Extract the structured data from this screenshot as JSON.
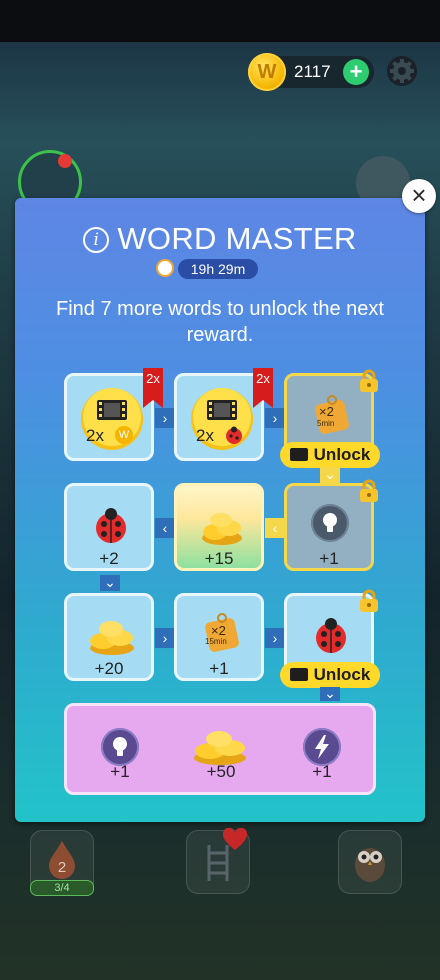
{
  "header": {
    "coins": "2117",
    "coin_symbol": "W"
  },
  "dialog": {
    "title": "WORD MASTER",
    "info_glyph": "i",
    "timer": "19h 29m",
    "subtitle": "Find 7 more words to unlock the next reward.",
    "close_glyph": "×"
  },
  "grid": {
    "r1c1": {
      "label": "2x",
      "badge": "2x",
      "icon": "film-coin-icon",
      "mini": "W"
    },
    "r1c2": {
      "label": "2x",
      "badge": "2x",
      "icon": "film-ladybug-icon"
    },
    "r1c3": {
      "tag_top": "×2",
      "tag_bottom": "5min",
      "button": "Unlock",
      "icon": "boost-tag-icon"
    },
    "r2c1": {
      "label": "+2",
      "icon": "ladybug-icon"
    },
    "r2c2": {
      "label": "+15",
      "icon": "coin-pile-icon"
    },
    "r2c3": {
      "label": "+1",
      "icon": "lightbulb-icon"
    },
    "r3c1": {
      "label": "+20",
      "icon": "coin-pile-icon"
    },
    "r3c2": {
      "label": "+1",
      "tag_top": "×2",
      "tag_bottom": "15min",
      "icon": "boost-tag-icon"
    },
    "r3c3": {
      "button": "Unlock",
      "icon": "ladybug-icon"
    }
  },
  "bonus": {
    "items": [
      {
        "label": "+1",
        "icon": "lightbulb-icon"
      },
      {
        "label": "+50",
        "icon": "coin-pile-icon"
      },
      {
        "label": "+1",
        "icon": "lightning-icon"
      }
    ]
  },
  "bottom": {
    "drop_level": "2",
    "drop_progress": "3/4"
  },
  "colors": {
    "dialog_top": "#5e86e4",
    "dialog_bottom": "#22c3c9",
    "unlock": "#ffd92a",
    "ribbon": "#d71c1c",
    "bonus_bg": "#e6a8ef"
  }
}
